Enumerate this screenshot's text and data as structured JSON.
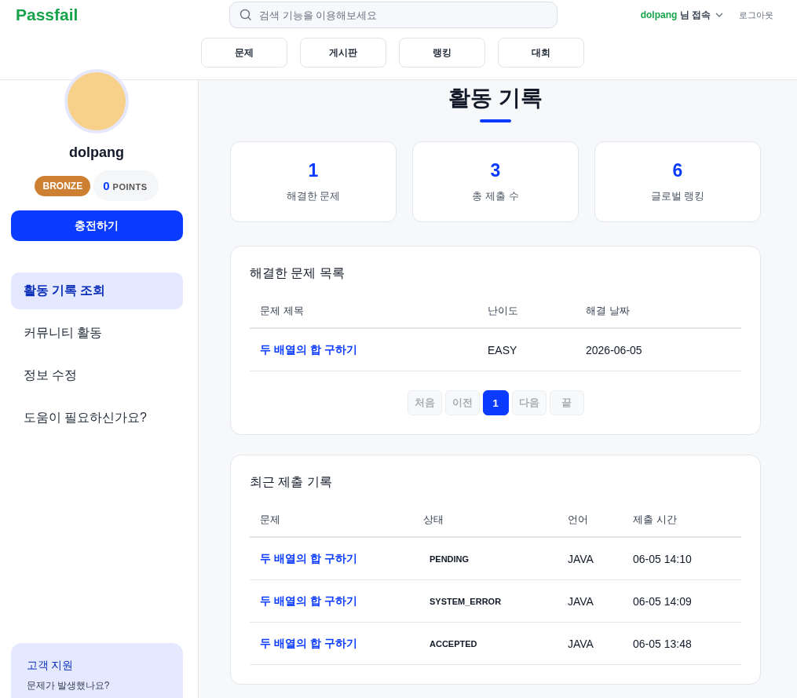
{
  "header": {
    "logo": "Passfail",
    "search": {
      "placeholder": "검색 기능을 이용해보세요"
    },
    "user": {
      "name": "dolpang",
      "suffix": "님 접속"
    },
    "logout": "로그아웃",
    "nav": [
      "문제",
      "게시판",
      "랭킹",
      "대회"
    ]
  },
  "sidebar": {
    "username": "dolpang",
    "tier": "BRONZE",
    "points": {
      "value": "0",
      "label": "POINTS"
    },
    "charge_button": "충전하기",
    "items": [
      {
        "label": "활동 기록 조회",
        "selected": true
      },
      {
        "label": "커뮤니티 활동",
        "selected": false
      },
      {
        "label": "정보 수정",
        "selected": false
      },
      {
        "label": "도움이 필요하신가요?",
        "selected": false
      }
    ],
    "support": {
      "title": "고객 지원",
      "lines": [
        "문제가 발생했나요?"
      ]
    }
  },
  "main": {
    "title": "활동 기록",
    "stats": [
      {
        "value": "1",
        "label": "해결한 문제"
      },
      {
        "value": "3",
        "label": "총 제출 수"
      },
      {
        "value": "6",
        "label": "글로벌 랭킹"
      }
    ],
    "solved": {
      "title": "해결한 문제 목록",
      "columns": [
        "문제 제목",
        "난이도",
        "해결 날짜"
      ],
      "rows": [
        [
          "두 배열의 합 구하기",
          "EASY",
          "2026-06-05"
        ]
      ],
      "pagination": [
        {
          "label": "처음",
          "kind": "nav",
          "selected": false
        },
        {
          "label": "이전",
          "kind": "nav",
          "selected": false
        },
        {
          "label": "1",
          "kind": "page",
          "selected": true
        },
        {
          "label": "다음",
          "kind": "nav",
          "selected": false
        },
        {
          "label": "끝",
          "kind": "nav",
          "selected": false
        }
      ]
    },
    "submissions": {
      "title": "최근 제출 기록",
      "columns": [
        "문제",
        "상태",
        "언어",
        "제출 시간"
      ],
      "rows": [
        [
          "두 배열의 합 구하기",
          "PENDING",
          "JAVA",
          "06-05 14:10"
        ],
        [
          "두 배열의 합 구하기",
          "SYSTEM_ERROR",
          "JAVA",
          "06-05 14:09"
        ],
        [
          "두 배열의 합 구하기",
          "ACCEPTED",
          "JAVA",
          "06-05 13:48"
        ]
      ]
    }
  }
}
